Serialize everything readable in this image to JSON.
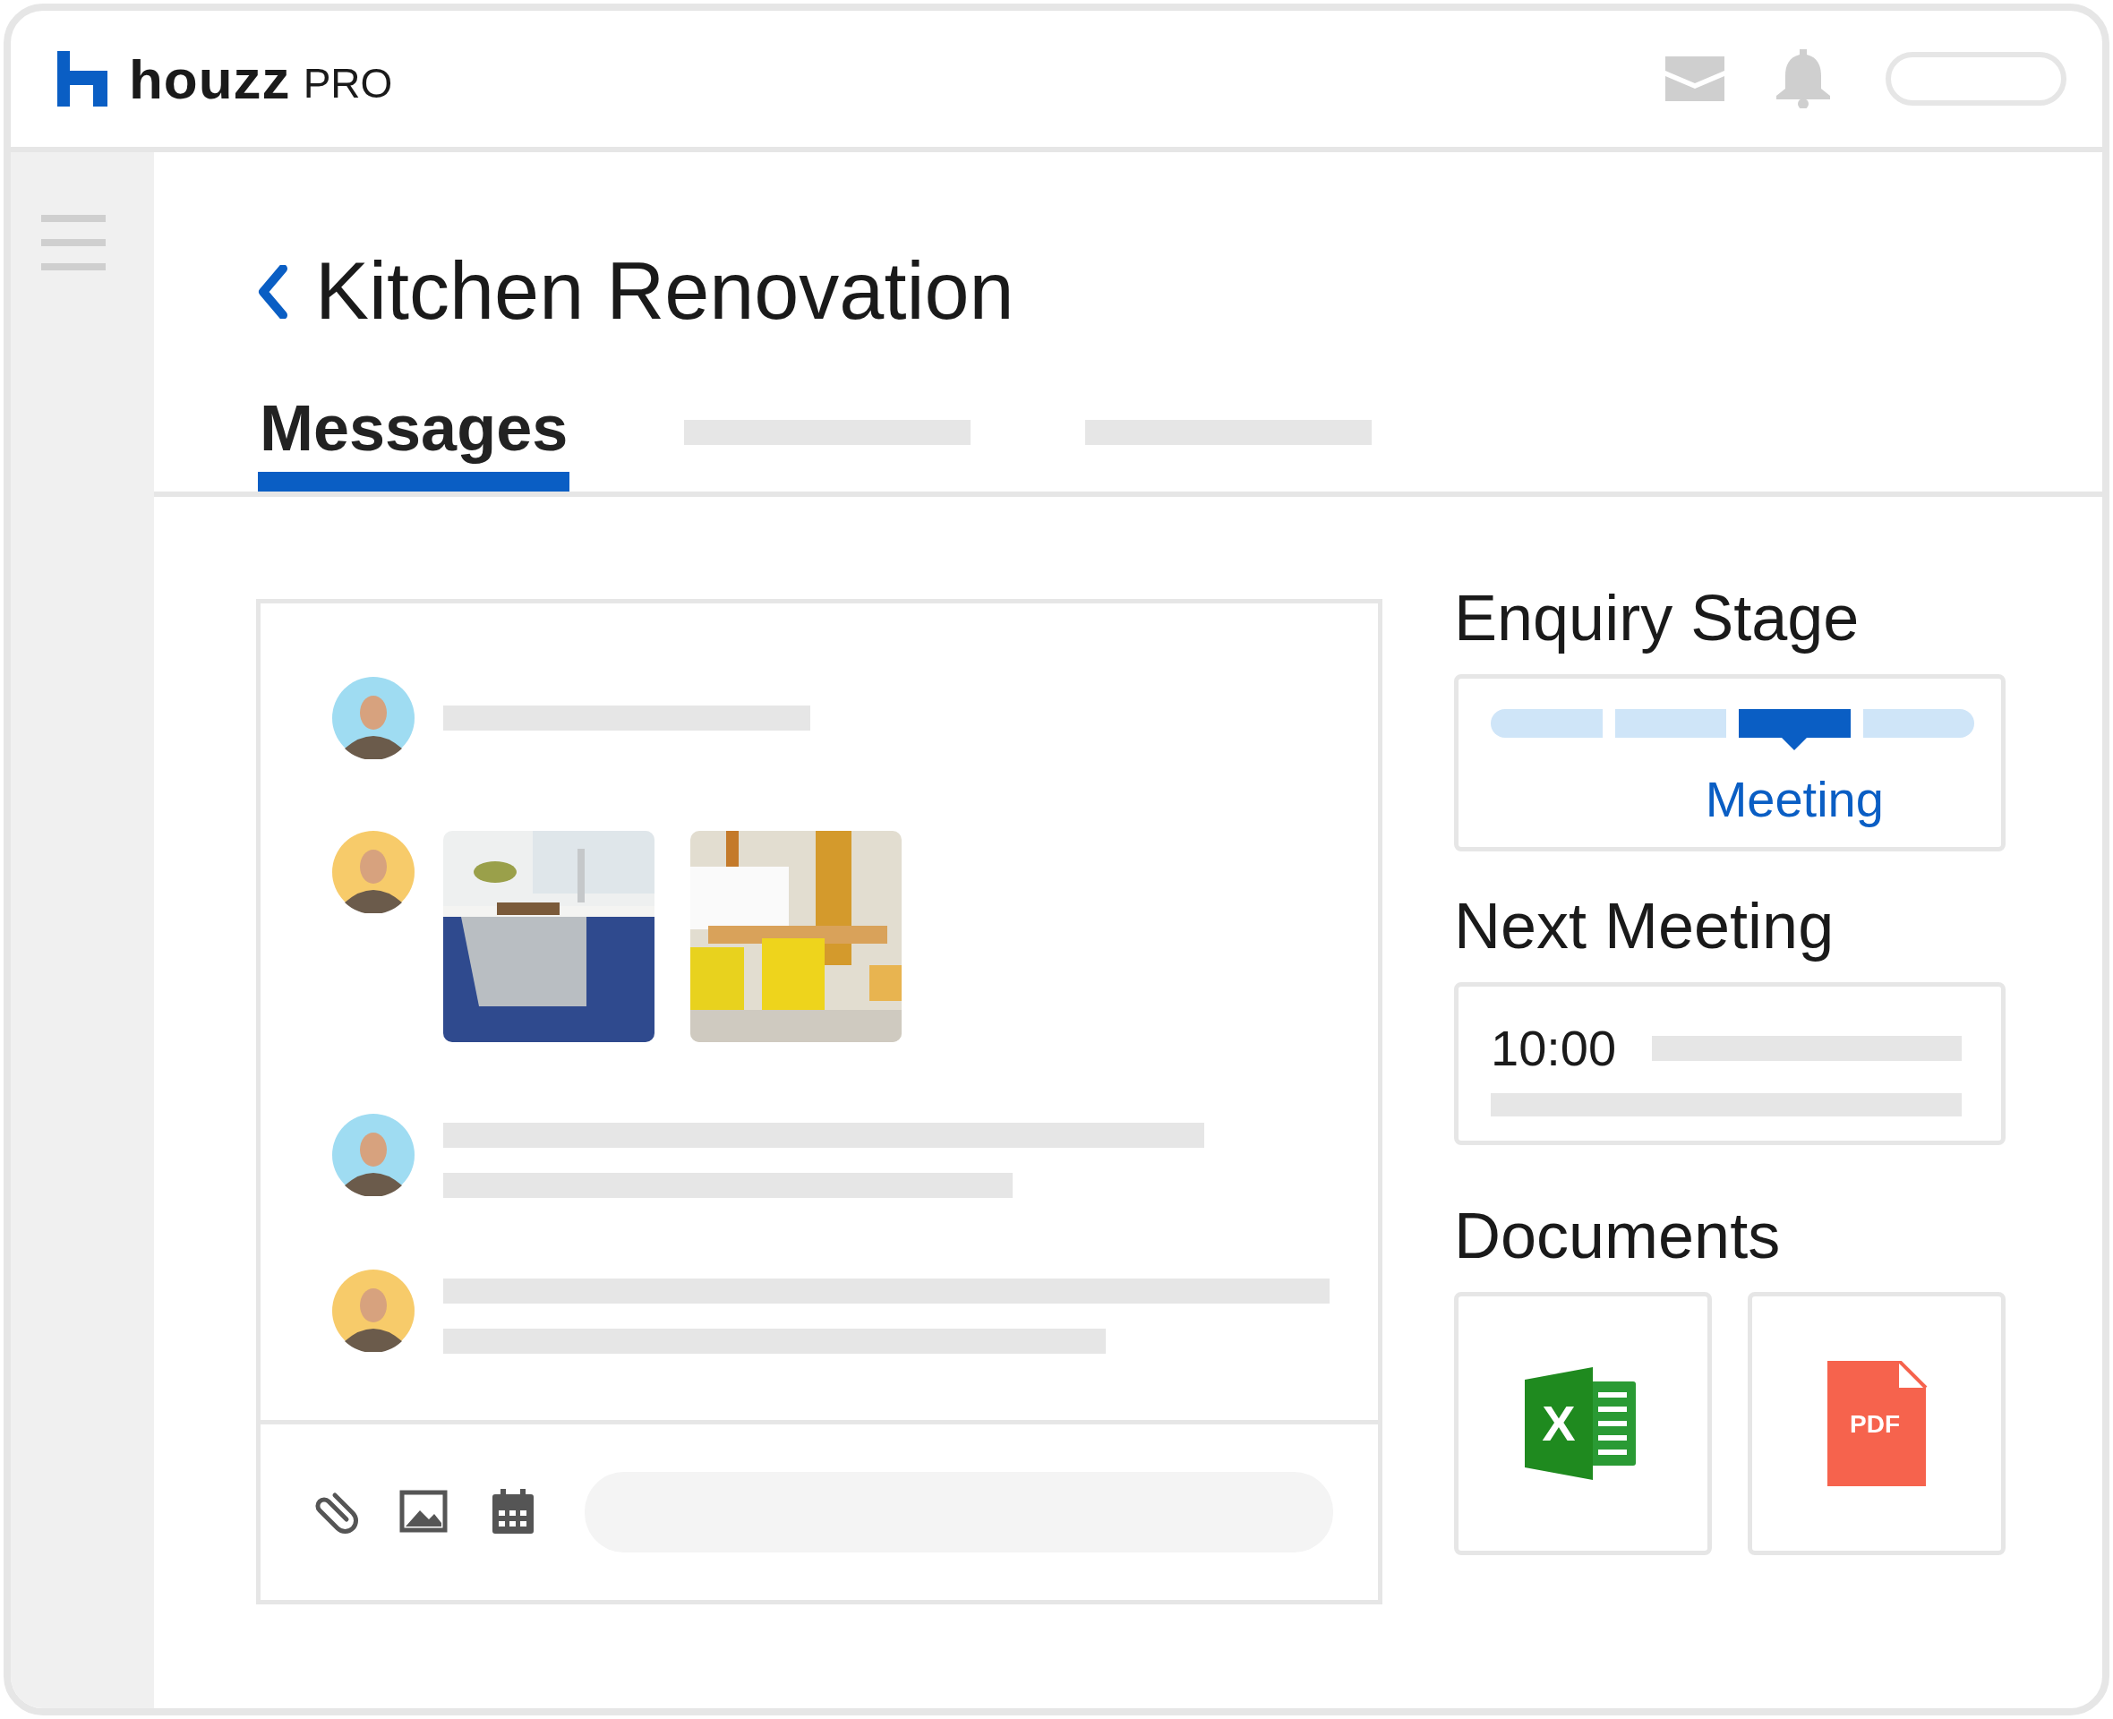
{
  "header": {
    "logo": {
      "brand": "houzz",
      "suffix": "PRO"
    }
  },
  "page": {
    "title": "Kitchen Renovation"
  },
  "tabs": [
    {
      "label": "Messages",
      "selected": true
    },
    {
      "selected": false
    },
    {
      "selected": false
    }
  ],
  "messages": [
    {
      "kind": "line",
      "color": "#9fdcf2"
    },
    {
      "kind": "photos",
      "color": "#f7cb6a"
    },
    {
      "kind": "lines",
      "color": "#9fdcf2"
    },
    {
      "kind": "lines",
      "color": "#f7cb6a"
    }
  ],
  "enquiry_stage": {
    "title": "Enquiry Stage",
    "stages": [
      {
        "selected": false
      },
      {
        "selected": false
      },
      {
        "selected": true
      },
      {
        "selected": false
      }
    ],
    "current_label": "Meeting"
  },
  "next_meeting": {
    "title": "Next Meeting",
    "time": "10:00"
  },
  "documents": {
    "title": "Documents",
    "files": [
      {
        "kind": "excel",
        "icon_text": "X"
      },
      {
        "kind": "pdf",
        "icon_text": "PDF"
      }
    ]
  }
}
